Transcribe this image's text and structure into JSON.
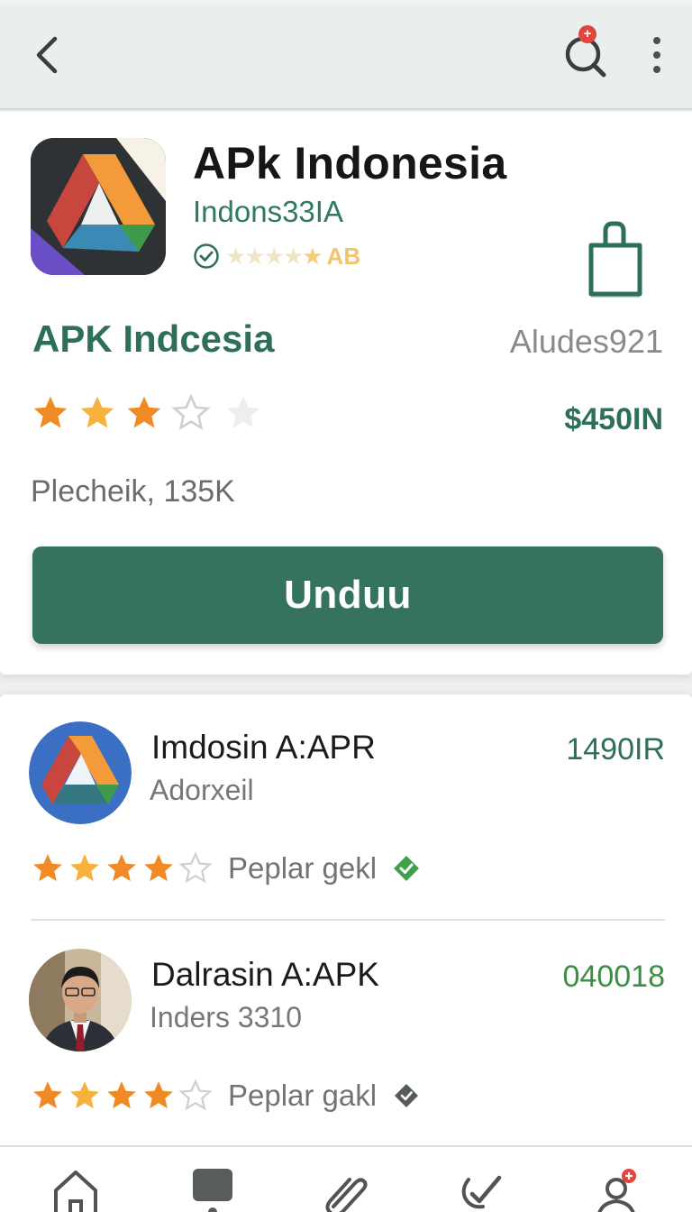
{
  "topbar": {
    "back_icon": "back-arrow-icon",
    "search_icon": "search-icon",
    "search_badge": "+",
    "menu_icon": "more-vertical-icon"
  },
  "app": {
    "title": "APk Indonesia",
    "developer": "Indons33IA",
    "verified_icon": "verified-check-icon",
    "rating_label": "AB",
    "name": "APK Indcesia",
    "id": "Aludes921",
    "rating": 3,
    "rating_max": 5,
    "price": "$450IN",
    "downloads": "Plecheik, 135K",
    "install_label": "Unduu",
    "share_icon": "shopping-bag-icon"
  },
  "related": [
    {
      "title": "Imdosin A:APR",
      "subtitle": "Adorxeil",
      "price": "1490IR",
      "rating": 4,
      "rating_label": "Peplar gekl",
      "badge_icon": "verified-badge-icon",
      "avatar_icon": "drive-logo-icon"
    },
    {
      "title": "Dalrasin A:APK",
      "subtitle": "Inders 3310",
      "price": "040018",
      "rating": 4,
      "rating_label": "Peplar gakl",
      "badge_icon": "diamond-badge-icon",
      "avatar_icon": "person-photo-icon"
    }
  ],
  "bottom_nav": [
    {
      "icon": "home-icon"
    },
    {
      "icon": "chat-icon"
    },
    {
      "icon": "paperclip-icon"
    },
    {
      "icon": "check-icon"
    },
    {
      "icon": "profile-icon"
    }
  ],
  "colors": {
    "accent": "#357260",
    "accent_text": "#2e6f5a",
    "star": "#f08a24",
    "star_light": "#f6b23c"
  }
}
